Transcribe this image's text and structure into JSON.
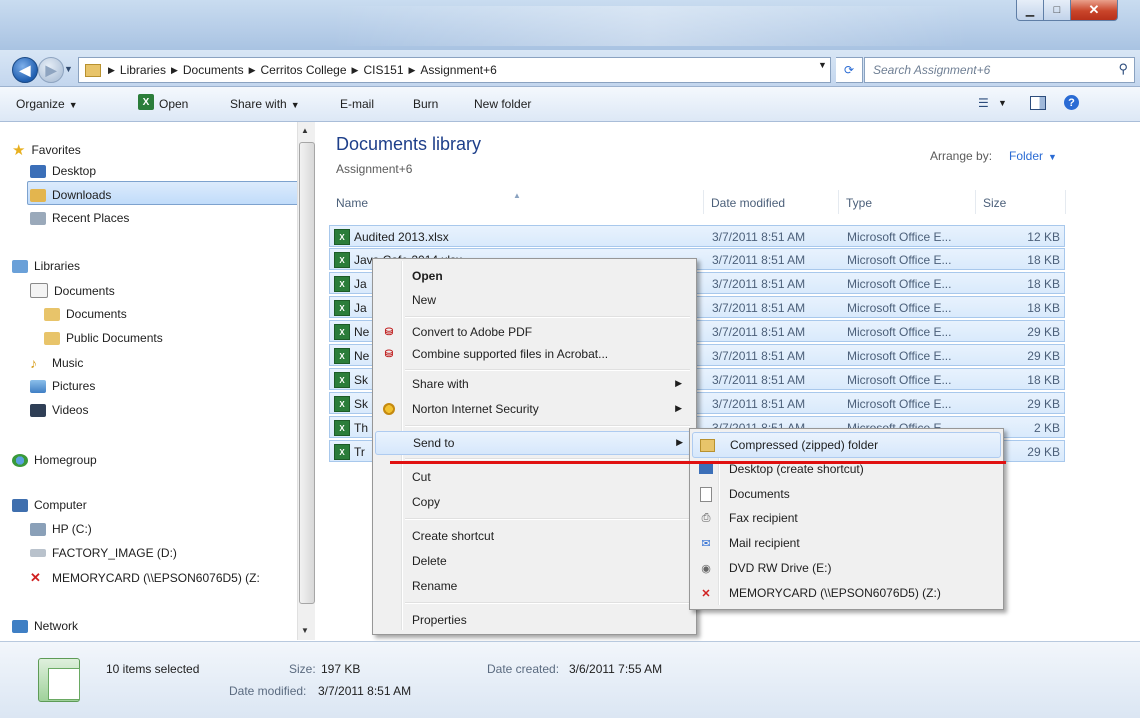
{
  "window": {
    "min_label": "▁",
    "max_label": "□",
    "close_label": "✕"
  },
  "nav": {
    "breadcrumbs": [
      "Libraries",
      "Documents",
      "Cerritos College",
      "CIS151",
      "Assignment+6"
    ],
    "search_placeholder": "Search Assignment+6"
  },
  "toolbar": {
    "organize": "Organize",
    "open": "Open",
    "share_with": "Share with",
    "email": "E-mail",
    "burn": "Burn",
    "new_folder": "New folder"
  },
  "sidebar": {
    "favorites": "Favorites",
    "desktop": "Desktop",
    "downloads": "Downloads",
    "recent_places": "Recent Places",
    "libraries": "Libraries",
    "documents": "Documents",
    "documents_sub": "Documents",
    "public_documents": "Public Documents",
    "music": "Music",
    "pictures": "Pictures",
    "videos": "Videos",
    "homegroup": "Homegroup",
    "computer": "Computer",
    "hp_c": "HP (C:)",
    "factory_image": "FACTORY_IMAGE (D:)",
    "memorycard": "MEMORYCARD (\\\\EPSON6076D5) (Z:",
    "network": "Network"
  },
  "library": {
    "title": "Documents library",
    "subtitle": "Assignment+6",
    "arrange_label": "Arrange by:",
    "arrange_value": "Folder"
  },
  "columns": {
    "name": "Name",
    "date": "Date modified",
    "type": "Type",
    "size": "Size"
  },
  "files": [
    {
      "name": "Audited 2013.xlsx",
      "date": "3/7/2011 8:51 AM",
      "type": "Microsoft Office E...",
      "size": "12 KB"
    },
    {
      "name": "Java Cafe 2014.xlsx",
      "date": "3/7/2011 8:51 AM",
      "type": "Microsoft Office E...",
      "size": "18 KB"
    },
    {
      "name": "Ja",
      "date": "3/7/2011 8:51 AM",
      "type": "Microsoft Office E...",
      "size": "18 KB"
    },
    {
      "name": "Ja",
      "date": "3/7/2011 8:51 AM",
      "type": "Microsoft Office E...",
      "size": "18 KB"
    },
    {
      "name": "Ne",
      "date": "3/7/2011 8:51 AM",
      "type": "Microsoft Office E...",
      "size": "29 KB"
    },
    {
      "name": "Ne",
      "date": "3/7/2011 8:51 AM",
      "type": "Microsoft Office E...",
      "size": "29 KB"
    },
    {
      "name": "Sk",
      "date": "3/7/2011 8:51 AM",
      "type": "Microsoft Office E...",
      "size": "18 KB"
    },
    {
      "name": "Sk",
      "date": "3/7/2011 8:51 AM",
      "type": "Microsoft Office E...",
      "size": "29 KB"
    },
    {
      "name": "Th",
      "date": "3/7/2011 8:51 AM",
      "type": "Microsoft Office E...",
      "size": "2 KB"
    },
    {
      "name": "Tr",
      "date": "",
      "type": "",
      "size": "29 KB"
    }
  ],
  "context_menu": {
    "open": "Open",
    "new": "New",
    "convert_pdf": "Convert to Adobe PDF",
    "combine": "Combine supported files in Acrobat...",
    "share_with": "Share with",
    "norton": "Norton Internet Security",
    "send_to": "Send to",
    "cut": "Cut",
    "copy": "Copy",
    "create_shortcut": "Create shortcut",
    "delete": "Delete",
    "rename": "Rename",
    "properties": "Properties"
  },
  "sendto_menu": {
    "zip": "Compressed (zipped) folder",
    "desktop": "Desktop (create shortcut)",
    "documents": "Documents",
    "fax": "Fax recipient",
    "mail": "Mail recipient",
    "dvd": "DVD RW Drive (E:)",
    "memorycard": "MEMORYCARD (\\\\EPSON6076D5) (Z:)"
  },
  "status": {
    "selected": "10 items selected",
    "size_label": "Size:",
    "size_value": "197 KB",
    "created_label": "Date created:",
    "created_value": "3/6/2011 7:55 AM",
    "modified_label": "Date modified:",
    "modified_value": "3/7/2011 8:51 AM"
  },
  "colors": {
    "accent": "#2a6bd4",
    "title_blue": "#1e3f8a",
    "annotation_red": "#e01010"
  }
}
